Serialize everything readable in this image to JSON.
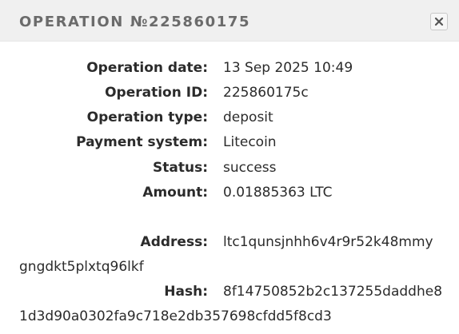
{
  "modal": {
    "title": "OPERATION №225860175",
    "close_icon": "close-icon"
  },
  "details": {
    "operation_date": {
      "label": "Operation date:",
      "value": "13 Sep 2025 10:49"
    },
    "operation_id": {
      "label": "Operation ID:",
      "value": "225860175c"
    },
    "operation_type": {
      "label": "Operation type:",
      "value": "deposit"
    },
    "payment_system": {
      "label": "Payment system:",
      "value": "Litecoin"
    },
    "status": {
      "label": "Status:",
      "value": "success"
    },
    "amount": {
      "label": "Amount:",
      "value": "0.01885363 LTC"
    },
    "address": {
      "label": "Address:",
      "value_line1": "ltc1qunsjnhh6v4r9r52k48mmy",
      "value_line2": "gngdkt5plxtq96lkf"
    },
    "hash": {
      "label": "Hash:",
      "value_line1": "8f14750852b2c137255daddhe8",
      "value_line2": "1d3d90a0302fa9c718e2db357698cfdd5f8cd3"
    }
  }
}
